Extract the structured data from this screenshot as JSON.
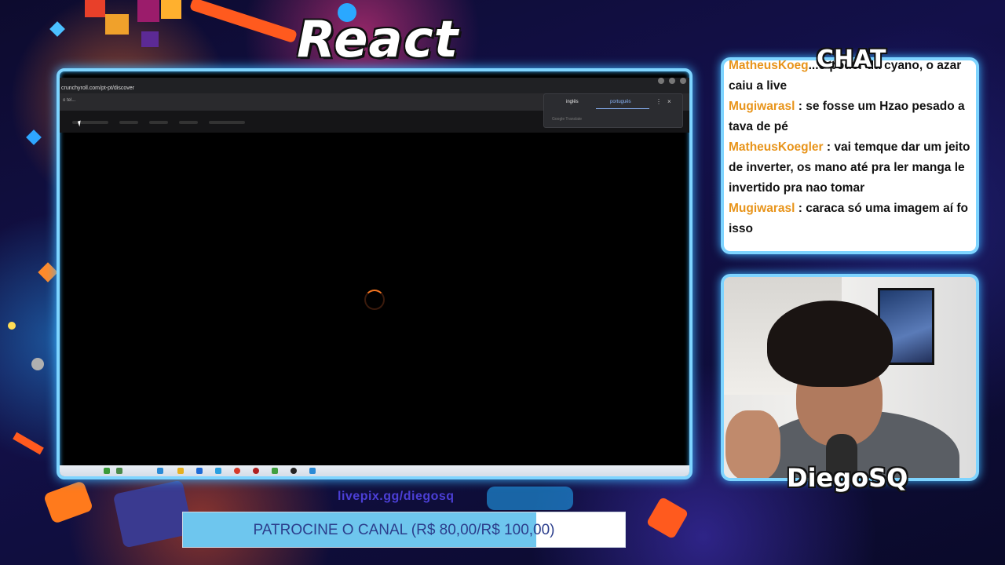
{
  "overlay": {
    "title": "React",
    "chat_label": "CHAT",
    "streamer": "DiegoSQ",
    "link": "livepix.gg/diegosq"
  },
  "browser": {
    "url": "crunchyroll.com/pt-pt/discover",
    "tab_text": "o tel...",
    "translate": {
      "lang_from": "inglês",
      "lang_to": "português",
      "brand": "Google Translate"
    }
  },
  "chat": {
    "messages": [
      {
        "user": "MatheusKoeg",
        "text": "...o poder da cyano, o azar caiu a live"
      },
      {
        "user": "Mugiwarasl",
        "text": " : se fosse um Hzao pesado a tava de pé"
      },
      {
        "user": "MatheusKoegler",
        "text": " : vai temque dar um jeito de inverter, os mano até pra ler manga le invertido pra nao tomar"
      },
      {
        "user": "Mugiwarasl",
        "text": " : caraca só uma imagem aí fo isso"
      }
    ]
  },
  "donation": {
    "label": "PATROCINE O CANAL (R$ 80,00/R$ 100,00)",
    "progress": 0.8,
    "fill_color": "#6ec6ee"
  },
  "colors": {
    "frame": "#7ed4ff",
    "chat_user": "#e8941a",
    "spinner": "#f47521"
  }
}
